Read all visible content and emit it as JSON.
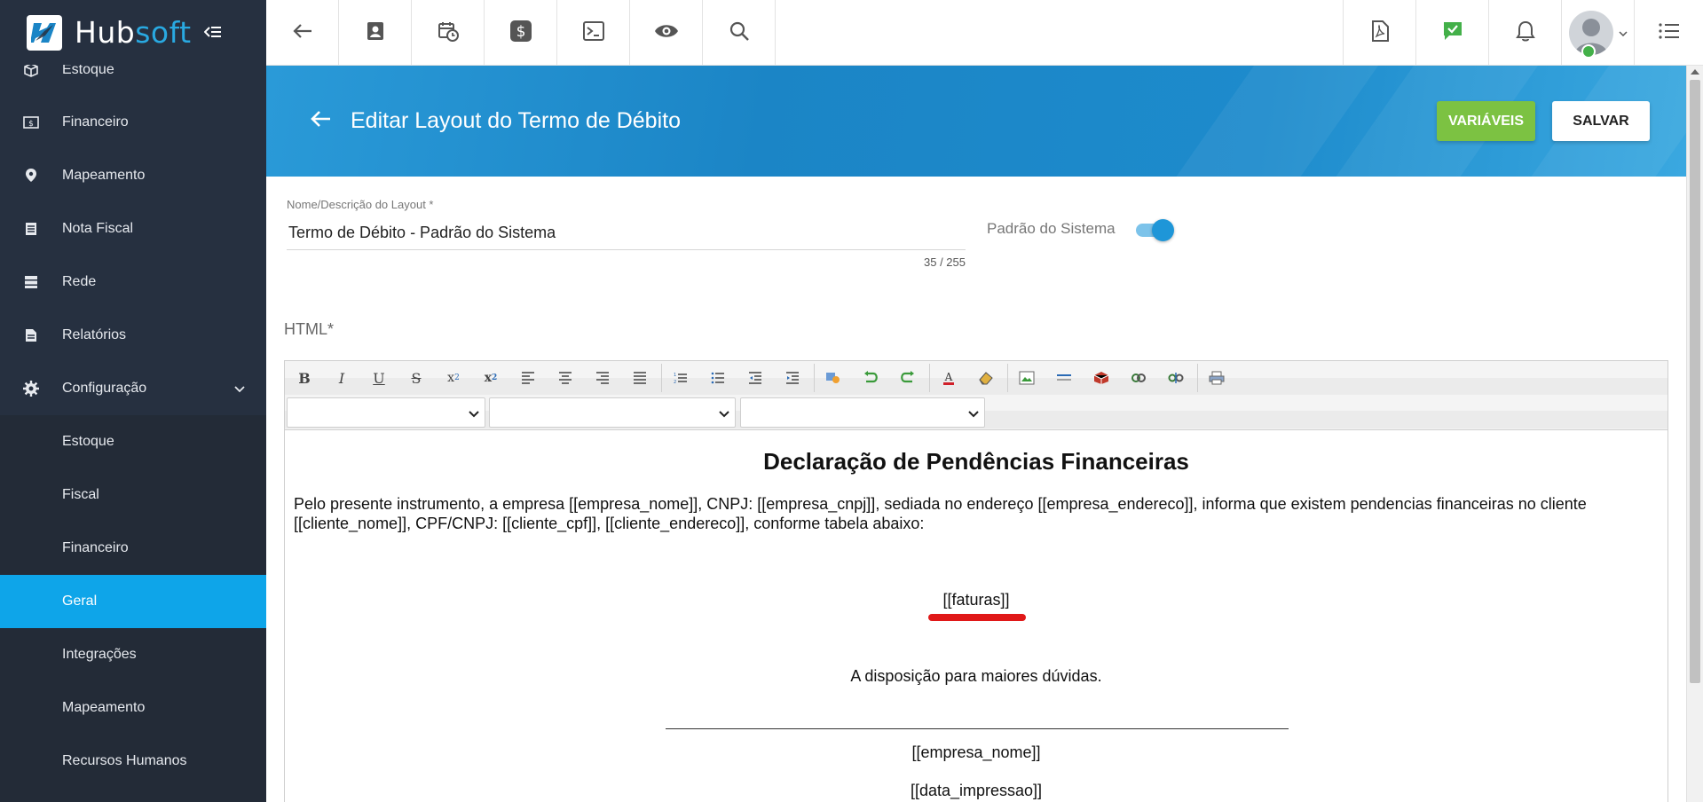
{
  "brand": {
    "part1": "Hub",
    "part2": "soft"
  },
  "sidebar": {
    "items": [
      {
        "label": "Estoque",
        "icon": "box-icon"
      },
      {
        "label": "Financeiro",
        "icon": "money-icon"
      },
      {
        "label": "Mapeamento",
        "icon": "map-pin-icon"
      },
      {
        "label": "Nota Fiscal",
        "icon": "document-icon"
      },
      {
        "label": "Rede",
        "icon": "server-icon"
      },
      {
        "label": "Relatórios",
        "icon": "report-icon"
      },
      {
        "label": "Configuração",
        "icon": "gear-icon",
        "expanded": true
      }
    ],
    "subitems": [
      {
        "label": "Estoque"
      },
      {
        "label": "Fiscal"
      },
      {
        "label": "Financeiro"
      },
      {
        "label": "Geral",
        "active": true
      },
      {
        "label": "Integrações"
      },
      {
        "label": "Mapeamento"
      },
      {
        "label": "Recursos Humanos"
      }
    ]
  },
  "header": {
    "title": "Editar Layout do Termo de Débito",
    "variables_button": "VARIÁVEIS",
    "save_button": "SALVAR"
  },
  "form": {
    "name_label": "Nome/Descrição do Layout *",
    "name_value": "Termo de Débito - Padrão do Sistema",
    "counter": "35 / 255",
    "system_default_label": "Padrão do Sistema",
    "system_default_on": true,
    "html_label": "HTML*"
  },
  "document": {
    "title": "Declaração de Pendências Financeiras",
    "paragraph": "Pelo presente instrumento, a empresa [[empresa_nome]], CNPJ: [[empresa_cnpj]], sediada no endereço [[empresa_endereco]], informa que existem pendencias financeiras no cliente [[cliente_nome]], CPF/CNPJ: [[cliente_cpf]], [[cliente_endereco]], conforme tabela abaixo:",
    "faturas": "[[faturas]]",
    "closing": "A disposição para maiores dúvidas.",
    "empresa": "[[empresa_nome]]",
    "data": "[[data_impressao]]"
  },
  "colors": {
    "sidebar_bg": "#263040",
    "active": "#0ea5e9",
    "banner": "#1d8bcc",
    "green": "#7cc242",
    "highlight": "#e01818"
  }
}
